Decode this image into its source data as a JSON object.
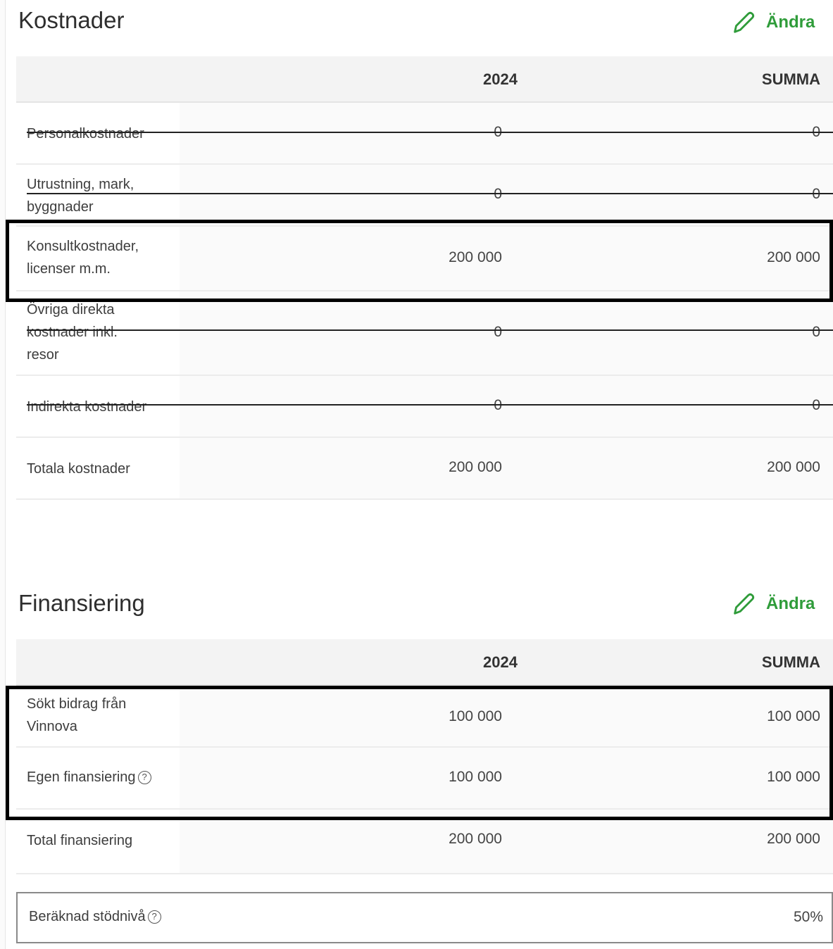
{
  "costs": {
    "title": "Kostnader",
    "edit_label": "Ändra",
    "header": {
      "year": "2024",
      "sum": "SUMMA"
    },
    "rows": [
      {
        "label": "Personalkostnader",
        "year": "0",
        "sum": "0",
        "struck": true
      },
      {
        "label": "Utrustning, mark, byggnader",
        "year": "0",
        "sum": "0",
        "struck": true
      },
      {
        "label": "Konsultkostnader, licenser m.m.",
        "year": "200 000",
        "sum": "200 000",
        "struck": false
      },
      {
        "label": "Övriga direkta kostnader inkl. resor",
        "year": "0",
        "sum": "0",
        "struck": true
      },
      {
        "label": "Indirekta kostnader",
        "year": "0",
        "sum": "0",
        "struck": true
      },
      {
        "label": "Totala kostnader",
        "year": "200 000",
        "sum": "200 000",
        "struck": false
      }
    ]
  },
  "financing": {
    "title": "Finansiering",
    "edit_label": "Ändra",
    "header": {
      "year": "2024",
      "sum": "SUMMA"
    },
    "rows": [
      {
        "label": "Sökt bidrag från Vinnova",
        "year": "100 000",
        "sum": "100 000"
      },
      {
        "label": "Egen finansiering",
        "year": "100 000",
        "sum": "100 000",
        "help": "?"
      },
      {
        "label": "Total finansiering",
        "year": "200 000",
        "sum": "200 000"
      }
    ]
  },
  "support_level": {
    "label": "Beräknad stödnivå",
    "value": "50%",
    "help": "?"
  },
  "colors": {
    "accent_green": "#2f9c3a",
    "highlight_border": "#000000"
  },
  "icons": {
    "edit": "pencil-icon",
    "help": "question-circle-icon"
  }
}
